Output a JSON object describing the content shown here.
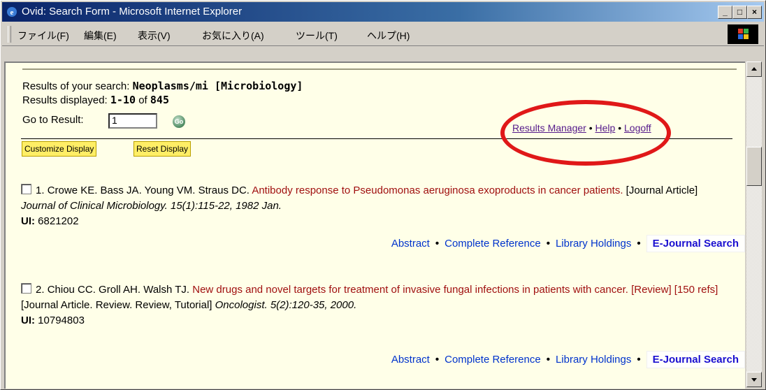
{
  "window": {
    "title": "Ovid: Search Form - Microsoft Internet Explorer",
    "minimize": "_",
    "maximize": "□",
    "close": "×"
  },
  "menu": [
    "ファイル(F)",
    "編集(E)",
    "表示(V)",
    "お気に入り(A)",
    "ツール(T)",
    "ヘルプ(H)"
  ],
  "search": {
    "results_label": "Results of your search: ",
    "query": "Neoplasms/mi [Microbiology]",
    "displayed_label": "Results displayed: ",
    "range": "1-10",
    "of": " of ",
    "total": "845",
    "goto_label": "Go to Result:",
    "goto_value": "1",
    "go_label": "Go"
  },
  "toplinks": {
    "results_manager": "Results Manager",
    "help": "Help",
    "logoff": "Logoff",
    "sep": " • "
  },
  "display_buttons": {
    "customize": "Customize Display",
    "reset": "Reset Display"
  },
  "results": [
    {
      "num": "1.",
      "authors": "Crowe KE. Bass JA. Young VM. Straus DC.",
      "title": "Antibody response to Pseudomonas aeruginosa exoproducts in cancer patients.",
      "type": "[Journal Article]",
      "source": "Journal of Clinical Microbiology. 15(1):115-22, 1982 Jan.",
      "ui_label": "UI:",
      "ui": "6821202"
    },
    {
      "num": "2.",
      "authors": "Chiou CC. Groll AH. Walsh TJ.",
      "title": "New drugs and novel targets for treatment of invasive fungal infections in patients with cancer. [Review] [150 refs]",
      "type": "[Journal Article. Review. Review, Tutorial]",
      "source": "Oncologist. 5(2):120-35, 2000.",
      "ui_label": "UI:",
      "ui": "10794803"
    }
  ],
  "result_links": {
    "abstract": "Abstract",
    "complete": "Complete Reference",
    "holdings": "Library Holdings",
    "ejournal": "E-Journal Search",
    "dot": "•"
  },
  "colors": {
    "page_bg": "#ffffe8",
    "title_red": "#a01010",
    "link_blue": "#0033cc",
    "annotation_red": "#e01818"
  }
}
